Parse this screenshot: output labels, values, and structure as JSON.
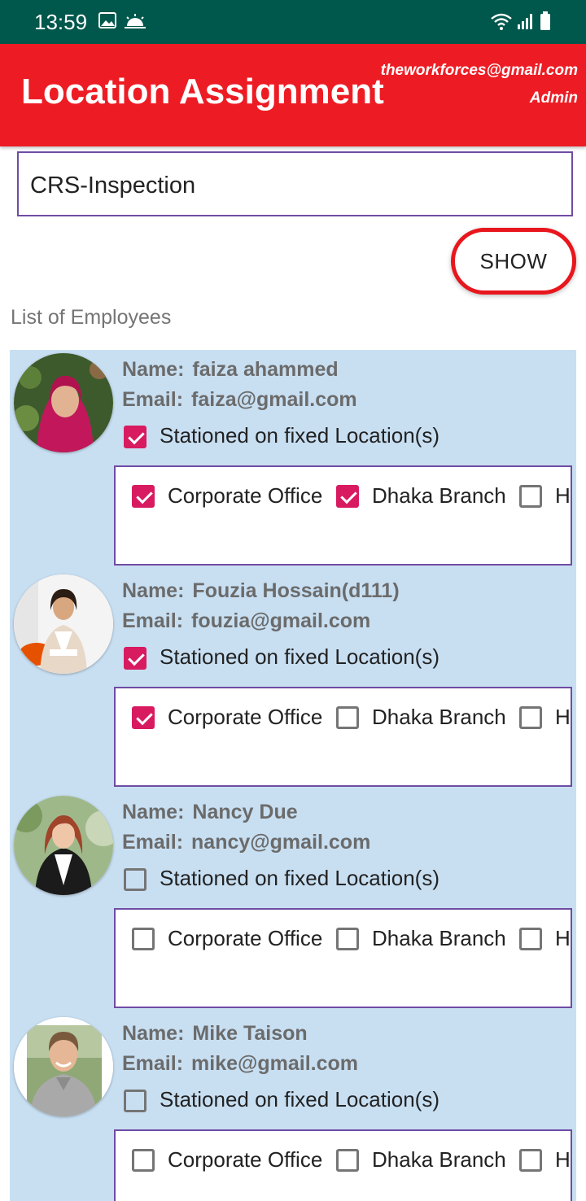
{
  "status_bar": {
    "time": "13:59",
    "left_icons": [
      "image-icon",
      "weather-icon"
    ],
    "right_icons": [
      "wifi-icon",
      "signal-icon",
      "battery-icon"
    ]
  },
  "app_bar": {
    "title": "Location Assignment",
    "user_email": "theworkforces@gmail.com",
    "user_role": "Admin",
    "color": "#ed1c24"
  },
  "project_select": {
    "value": "CRS-Inspection"
  },
  "show_button": {
    "label": "SHOW"
  },
  "list": {
    "heading": "List of Employees",
    "name_label": "Name:",
    "email_label": "Email:",
    "fixed_label": "Stationed on fixed Location(s)",
    "location_labels": [
      "Corporate Office",
      "Dhaka Branch",
      "H"
    ],
    "employees": [
      {
        "name": "faiza ahammed",
        "email": "faiza@gmail.com",
        "fixed": true,
        "locations": [
          true,
          true,
          false
        ]
      },
      {
        "name": "Fouzia Hossain(d111)",
        "email": "fouzia@gmail.com",
        "fixed": true,
        "locations": [
          true,
          false,
          false
        ]
      },
      {
        "name": "Nancy Due",
        "email": "nancy@gmail.com",
        "fixed": false,
        "locations": [
          false,
          false,
          false
        ]
      },
      {
        "name": "Mike Taison",
        "email": "mike@gmail.com",
        "fixed": false,
        "locations": [
          false,
          false,
          false
        ]
      }
    ]
  },
  "colors": {
    "status_bar": "#00574b",
    "checkbox_checked": "#d81b60",
    "list_background": "#c8dff2",
    "border": "#6f4ca4"
  }
}
